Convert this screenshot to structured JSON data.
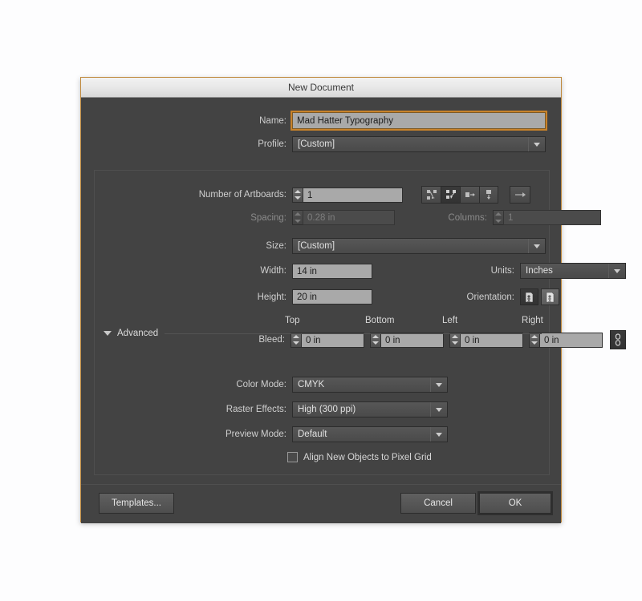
{
  "window": {
    "title": "New Document"
  },
  "fields": {
    "name_label": "Name:",
    "name_value": "Mad Hatter Typography",
    "profile_label": "Profile:",
    "profile_value": "[Custom]",
    "artboards_label": "Number of Artboards:",
    "artboards_value": "1",
    "spacing_label": "Spacing:",
    "spacing_value": "0.28 in",
    "columns_label": "Columns:",
    "columns_value": "1",
    "size_label": "Size:",
    "size_value": "[Custom]",
    "width_label": "Width:",
    "width_value": "14 in",
    "height_label": "Height:",
    "height_value": "20 in",
    "units_label": "Units:",
    "units_value": "Inches",
    "orientation_label": "Orientation:"
  },
  "bleed": {
    "label": "Bleed:",
    "headers": [
      "Top",
      "Bottom",
      "Left",
      "Right"
    ],
    "values": [
      "0 in",
      "0 in",
      "0 in",
      "0 in"
    ],
    "link_icon": "chain-link-icon"
  },
  "advanced": {
    "title": "Advanced",
    "color_mode_label": "Color Mode:",
    "color_mode_value": "CMYK",
    "raster_label": "Raster Effects:",
    "raster_value": "High (300 ppi)",
    "preview_label": "Preview Mode:",
    "preview_value": "Default",
    "align_checkbox_label": "Align New Objects to Pixel Grid",
    "align_checked": false
  },
  "artboard_arrange": {
    "icons": [
      "grid-by-row-icon",
      "grid-by-column-icon",
      "arrange-by-row-icon",
      "arrange-by-column-icon"
    ],
    "selected_index": 1,
    "direction_icon": "right-to-left-arrow-icon"
  },
  "orientation": {
    "portrait_icon": "portrait-orientation-icon",
    "landscape_icon": "landscape-orientation-icon",
    "selected": "portrait"
  },
  "footer": {
    "templates_label": "Templates...",
    "cancel_label": "Cancel",
    "ok_label": "OK"
  },
  "colors": {
    "accent": "#c8822a",
    "dialog_bg": "#434343",
    "input_bg": "#a9a9a9",
    "window_border": "#c08a3e"
  }
}
